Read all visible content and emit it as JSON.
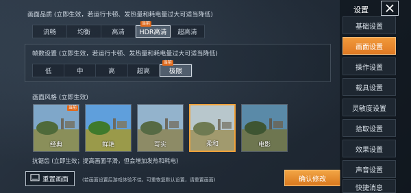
{
  "quality": {
    "title": "画面品质 (立即生效，若运行卡顿、发热量和耗电量过大可适当降低)",
    "options": [
      {
        "label": "流畅",
        "badge": ""
      },
      {
        "label": "均衡",
        "badge": ""
      },
      {
        "label": "高清",
        "badge": ""
      },
      {
        "label": "HDR高清",
        "badge": "当前"
      },
      {
        "label": "超高清",
        "badge": ""
      }
    ],
    "selected_index": 3
  },
  "fps": {
    "title": "帧数设置 (立即生效，若运行卡顿、发热量和耗电量过大可适当降低)",
    "options": [
      {
        "label": "低"
      },
      {
        "label": "中"
      },
      {
        "label": "高"
      },
      {
        "label": "超高"
      },
      {
        "label": "极限",
        "badge": "当前"
      }
    ],
    "selected_index": 4
  },
  "style": {
    "title": "画面风格 (立即生效)",
    "thumbs": [
      {
        "label": "经典",
        "badge": "当前"
      },
      {
        "label": "鲜艳",
        "badge": ""
      },
      {
        "label": "写实",
        "badge": ""
      },
      {
        "label": "柔和",
        "badge": ""
      },
      {
        "label": "电影",
        "badge": ""
      }
    ],
    "selected_index": 3
  },
  "antialias": {
    "text": "抗锯齿 (立即生效；提高画面平滑，但会增加发热和耗电)"
  },
  "footer": {
    "reset_label": "重置画面",
    "reset_note": "(若画面设置后游戏体验不佳，可重恢复默认设置，请重置画面)",
    "confirm_label": "确认修改"
  },
  "sidebar": {
    "title": "设置",
    "items": [
      "基础设置",
      "画面设置",
      "操作设置",
      "载具设置",
      "灵敏度设置",
      "拾取设置",
      "效果设置",
      "声音设置",
      "快捷消息"
    ],
    "active_index": 1
  },
  "colors": {
    "accent": "#e8872c",
    "badge": "#e06a1c"
  },
  "icons": [
    "reset-icon",
    "close-icon"
  ]
}
